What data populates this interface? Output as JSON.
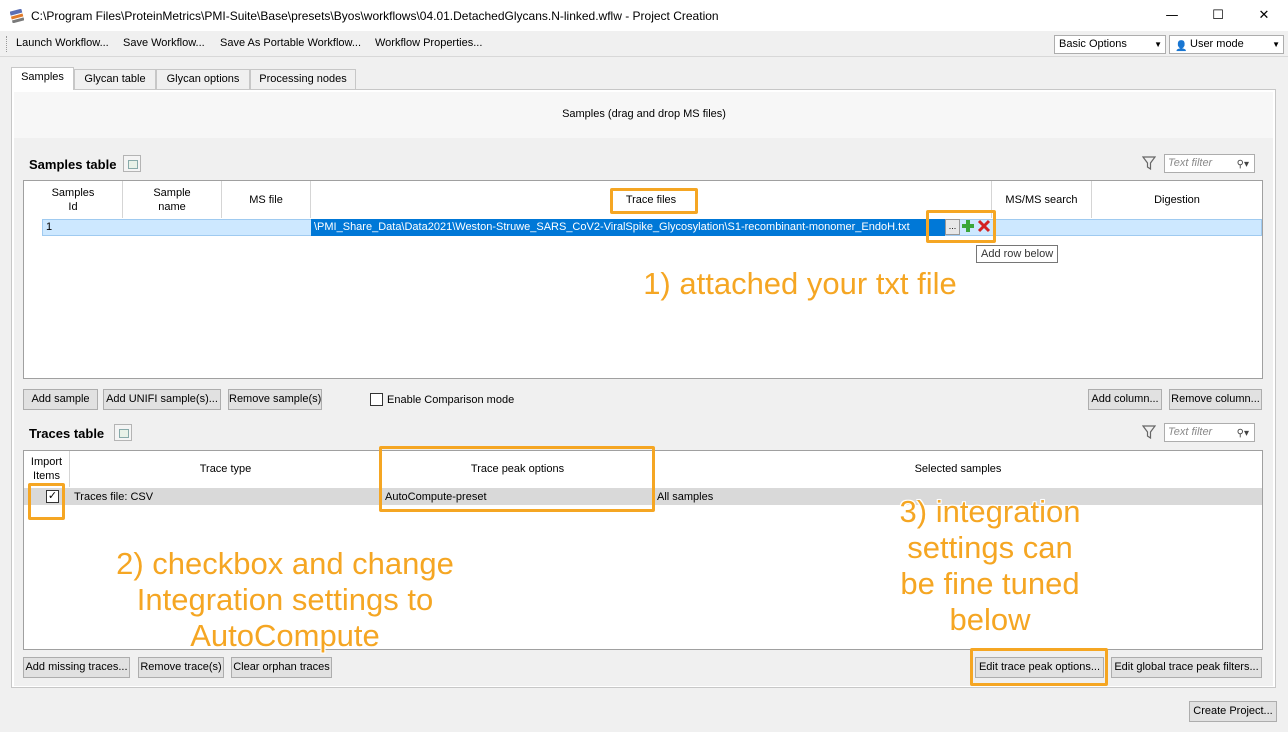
{
  "window": {
    "title": "C:\\Program Files\\ProteinMetrics\\PMI-Suite\\Base\\presets\\Byos\\workflows\\04.01.DetachedGlycans.N-linked.wflw - Project Creation",
    "minimize": "—",
    "maximize": "☐",
    "close": "✕"
  },
  "menu": {
    "items": [
      "Launch Workflow...",
      "Save Workflow...",
      "Save As Portable Workflow...",
      "Workflow Properties..."
    ],
    "options_combo": "Basic Options",
    "mode_combo": "User mode"
  },
  "tabs": [
    "Samples",
    "Glycan table",
    "Glycan options",
    "Processing nodes"
  ],
  "samples": {
    "drop_text": "Samples (drag and drop MS files)",
    "title": "Samples table",
    "filter_placeholder": "Text filter",
    "columns": [
      "Samples\nId",
      "Sample\nname",
      "MS file",
      "Trace files",
      "MS/MS search",
      "Digestion"
    ],
    "row": {
      "id": "1",
      "trace_files": "\\PMI_Share_Data\\Data2021\\Weston-Struwe_SARS_CoV2-ViralSpike_Glycosylation\\S1-recombinant-monomer_EndoH.txt"
    },
    "ellipsis": "...",
    "tooltip": "Add row below",
    "buttons": {
      "add_sample": "Add sample",
      "add_unifi": "Add UNIFI sample(s)...",
      "remove_sample": "Remove sample(s)",
      "comparison": "Enable Comparison mode",
      "add_column": "Add column...",
      "remove_column": "Remove column..."
    }
  },
  "traces": {
    "title": "Traces table",
    "filter_placeholder": "Text filter",
    "columns": [
      "Import\nItems",
      "Trace type",
      "Trace peak options",
      "Selected samples"
    ],
    "row": {
      "checked": true,
      "trace_type": "Traces file: CSV",
      "peak_options": "AutoCompute-preset",
      "selected_samples": "All samples"
    },
    "buttons": {
      "add_missing": "Add missing traces...",
      "remove_trace": "Remove trace(s)",
      "clear_orphan": "Clear orphan traces",
      "edit_peak": "Edit trace peak options...",
      "edit_global": "Edit global trace peak filters..."
    }
  },
  "footer": {
    "create_project": "Create Project..."
  },
  "annotations": {
    "note1": "1) attached your txt file",
    "note2": "2) checkbox and change\nIntegration settings to\nAutoCompute",
    "note3": "3) integration\nsettings can\nbe fine tuned\nbelow",
    "color": "#f5a623"
  },
  "colors": {
    "selection": "#0078d7",
    "row_selected": "#cde8ff",
    "row_grey": "#d9d9d9"
  }
}
